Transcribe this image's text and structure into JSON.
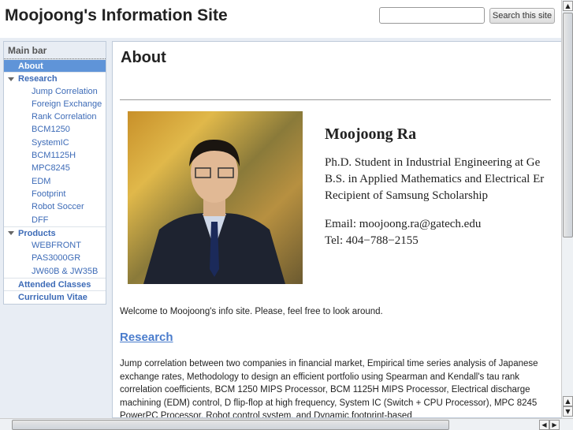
{
  "header": {
    "site_title": "Moojoong's Information Site",
    "search_placeholder": "",
    "search_button": "Search this site"
  },
  "sidebar": {
    "heading": "Main bar",
    "about": "About",
    "research": {
      "label": "Research",
      "items": [
        "Jump Correlation",
        "Foreign Exchange",
        "Rank Correlation",
        "BCM1250",
        "SystemIC",
        "BCM1125H",
        "MPC8245",
        "EDM",
        "Footprint",
        "Robot Soccer",
        "DFF"
      ]
    },
    "products": {
      "label": "Products",
      "items": [
        "WEBFRONT",
        "PAS3000GR",
        "JW60B & JW35B"
      ]
    },
    "attended": "Attended Classes",
    "cv": "Curriculum Vitae"
  },
  "main": {
    "title": "About",
    "bio": {
      "name": "Moojoong Ra",
      "line1": "Ph.D. Student in Industrial Engineering at Ge",
      "line2": "B.S. in Applied Mathematics and Electrical Er",
      "line3": "Recipient of Samsung Scholarship",
      "email": "Email: moojoong.ra@gatech.edu",
      "tel": "Tel: 404−788−2155"
    },
    "welcome": "Welcome to Moojoong's info site. Please, feel free to look around.",
    "research_heading": "Research",
    "research_text": "Jump correlation between two companies in financial market, Empirical time series analysis of Japanese exchange rates, Methodology to design an efficient portfolio using Spearman and Kendall's tau rank correlation coefficients, BCM 1250 MIPS Processor, BCM 1125H MIPS Processor, Electrical discharge machining (EDM) control, D flip-flop at high frequency, System IC (Switch + CPU Processor), MPC 8245 PowerPC Processor, Robot control system, and Dynamic footprint-based"
  },
  "scroll": {
    "up": "▲",
    "down": "▼",
    "left": "◀",
    "right": "▶"
  }
}
